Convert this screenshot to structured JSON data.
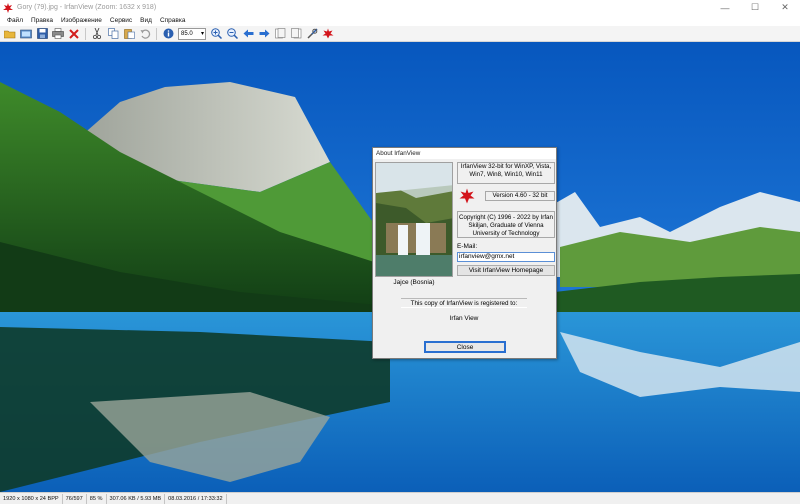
{
  "window": {
    "title": "Gory (79).jpg - IrfanView (Zoom: 1632 x 918)",
    "controls": [
      "—",
      "☐",
      "✕"
    ]
  },
  "menu": [
    "Файл",
    "Правка",
    "Изображение",
    "Сервис",
    "Вид",
    "Справка"
  ],
  "toolbar": {
    "icons": [
      "open-folder-icon",
      "slideshow-icon",
      "save-icon",
      "print-icon",
      "delete-icon",
      "cut-icon",
      "copy-icon",
      "paste-icon",
      "undo-icon",
      "info-icon",
      "zoom-in-icon",
      "zoom-out-icon",
      "previous-icon",
      "next-icon",
      "first-page-icon",
      "last-page-icon",
      "settings-icon",
      "irfanview-logo-icon"
    ],
    "zoom_value": "85.0"
  },
  "about": {
    "title": "About  IrfanView",
    "platform": "IrfanView 32-bit for WinXP, Vista, Win7, Win8, Win10, Win11",
    "version": "Version 4.60 - 32 bit",
    "copyright": "Copyright (C) 1996 - 2022 by Irfan Skiljan, Graduate of Vienna University of Technology",
    "email_label": "E-Mail:",
    "email_value": "irfanview@gmx.net",
    "homepage_button": "Visit IrfanView Homepage",
    "photo_caption": "Jajce (Bosnia)",
    "registered_text": "This copy of IrfanView is registered to:",
    "registered_user": "Irfan View",
    "close_button": "Close"
  },
  "status": [
    "1920 x 1080 x 24 BPP",
    "76/597",
    "85 %",
    "307.06 KB / 5.93 MB",
    "08.03.2016 / 17:33:32"
  ],
  "colors": {
    "sky": "#0a63c9",
    "lake": "#1f93d8",
    "accent_border": "#2a6fd0",
    "logo_red": "#d3141b"
  }
}
